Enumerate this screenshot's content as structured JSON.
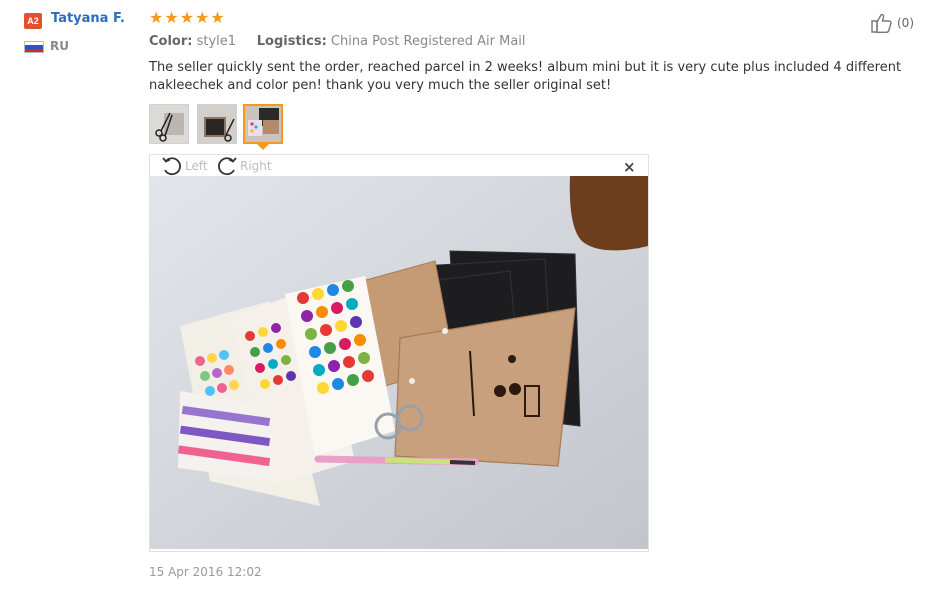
{
  "user": {
    "badge": "A2",
    "name": "Tatyana F.",
    "country": "RU"
  },
  "rating": {
    "stars": 5,
    "max": 5
  },
  "meta": {
    "color_label": "Color:",
    "color_value": "style1",
    "logistics_label": "Logistics:",
    "logistics_value": "China Post Registered Air Mail"
  },
  "helpful": {
    "count": "(0)"
  },
  "review": {
    "text": "The seller quickly sent the order, reached parcel in 2 weeks! album mini but it is very cute plus included 4 different nakleechek and color pen! thank you very much the seller original set!"
  },
  "viewer": {
    "rotate_left": "Left",
    "rotate_right": "Right",
    "close": "×"
  },
  "date": "15 Apr 2016 12:02",
  "colors": {
    "accent": "#f39a1d",
    "link": "#2c6dbd",
    "badge": "#e4502d"
  }
}
